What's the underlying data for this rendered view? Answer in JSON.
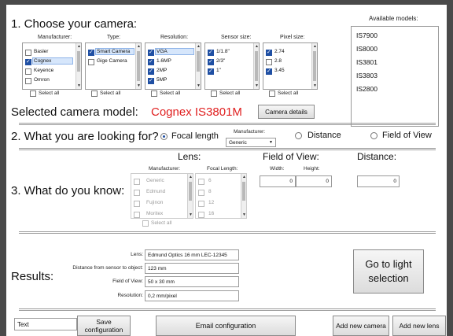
{
  "section1": {
    "title": "1. Choose your camera:",
    "manufacturer": {
      "label": "Manufacturer:",
      "items": [
        "Basler",
        "Cognex",
        "Keyence",
        "Omron"
      ],
      "checked": [
        false,
        true,
        false,
        false
      ],
      "select_all": "Select all"
    },
    "type": {
      "label": "Type:",
      "items": [
        "Smart Camera",
        "Gige Camera"
      ],
      "checked": [
        true,
        false
      ],
      "select_all": "Select all"
    },
    "resolution": {
      "label": "Resolution:",
      "items": [
        "VGA",
        "1.6MP",
        "2MP",
        "5MP"
      ],
      "checked": [
        true,
        true,
        true,
        true
      ],
      "select_all": "Select all"
    },
    "sensor_size": {
      "label": "Sensor size:",
      "items": [
        "1/1.8\"",
        "2/3\"",
        "1\""
      ],
      "checked": [
        true,
        true,
        true
      ],
      "select_all": "Select all"
    },
    "pixel_size": {
      "label": "Pixel size:",
      "items": [
        "2.74",
        "2.8",
        "3.45"
      ],
      "checked": [
        true,
        false,
        true
      ],
      "select_all": "Select all"
    },
    "available_models": {
      "label": "Available models:",
      "items": [
        "IS7900",
        "IS8000",
        "IS3801",
        "IS3803",
        "IS2800"
      ]
    },
    "selected_label": "Selected camera model:",
    "selected_value": "Cognex IS3801M",
    "details_button": "Camera details",
    "accent": "#e02020"
  },
  "section2": {
    "title": "2. What you are looking for?",
    "options": [
      "Focal length",
      "Distance",
      "Field of View"
    ],
    "selected_index": 0,
    "manufacturer_label": "Manufacturer:",
    "manufacturer_value": "Generic"
  },
  "section3": {
    "title": "3. What do you know:",
    "lens": {
      "heading": "Lens:",
      "manufacturer_label": "Manufacturer:",
      "manufacturers": [
        "Generic",
        "Edmund",
        "Fujinon",
        "Moritex"
      ],
      "focal_label": "Focal Length:",
      "focal_lengths": [
        "6",
        "8",
        "12",
        "16"
      ],
      "select_all": "Select all"
    },
    "fov": {
      "heading": "Field of View:",
      "width_label": "Width:",
      "height_label": "Height:",
      "width_value": "0",
      "height_value": "0"
    },
    "distance": {
      "heading": "Distance:",
      "value": "0"
    }
  },
  "results": {
    "title": "Results:",
    "rows": [
      {
        "label": "Lens:",
        "value": "Edmund Optics 16 mm LEC-12345"
      },
      {
        "label": "Distance from sensor to object:",
        "value": "123 mm"
      },
      {
        "label": "Field of View:",
        "value": "50 x 30 mm"
      },
      {
        "label": "Resolution:",
        "value": "0,2 mm/pixel"
      }
    ],
    "light_button": "Go to light selection"
  },
  "footer": {
    "text_field": "Text",
    "save_button": "Save configuration",
    "email_button": "Email configuration",
    "add_camera_button": "Add new camera",
    "add_lens_button": "Add new lens"
  }
}
